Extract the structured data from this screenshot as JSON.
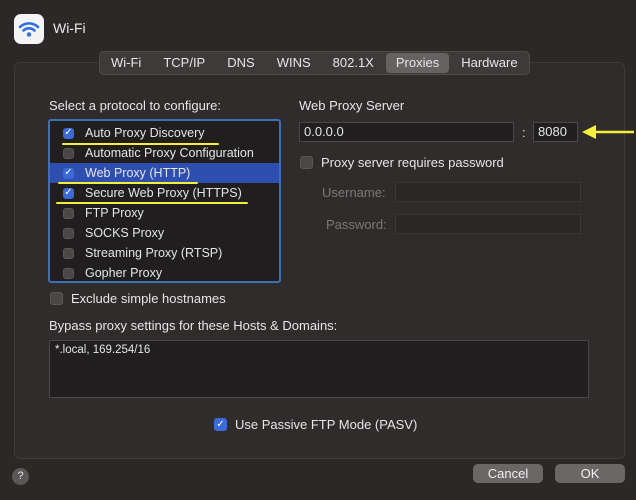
{
  "window": {
    "title": "Wi-Fi",
    "icon": "wifi-icon"
  },
  "tabs": [
    {
      "label": "Wi-Fi"
    },
    {
      "label": "TCP/IP"
    },
    {
      "label": "DNS"
    },
    {
      "label": "WINS"
    },
    {
      "label": "802.1X"
    },
    {
      "label": "Proxies",
      "active": true
    },
    {
      "label": "Hardware"
    }
  ],
  "protocols": {
    "heading": "Select a protocol to configure:",
    "items": [
      {
        "label": "Auto Proxy Discovery",
        "checked": true
      },
      {
        "label": "Automatic Proxy Configuration",
        "checked": false
      },
      {
        "label": "Web Proxy (HTTP)",
        "checked": true,
        "selected": true
      },
      {
        "label": "Secure Web Proxy (HTTPS)",
        "checked": true
      },
      {
        "label": "FTP Proxy",
        "checked": false
      },
      {
        "label": "SOCKS Proxy",
        "checked": false
      },
      {
        "label": "Streaming Proxy (RTSP)",
        "checked": false
      },
      {
        "label": "Gopher Proxy",
        "checked": false
      }
    ]
  },
  "exclude_simple": {
    "label": "Exclude simple hostnames",
    "checked": false
  },
  "server": {
    "heading": "Web Proxy Server",
    "address": "0.0.0.0",
    "separator": ":",
    "port": "8080",
    "requires_password_label": "Proxy server requires password",
    "username_label": "Username:",
    "password_label": "Password:"
  },
  "bypass": {
    "label": "Bypass proxy settings for these Hosts & Domains:",
    "value": "*.local, 169.254/16"
  },
  "passive_ftp": {
    "label": "Use Passive FTP Mode (PASV)",
    "checked": true
  },
  "buttons": {
    "help": "?",
    "cancel": "Cancel",
    "ok": "OK"
  },
  "colors": {
    "accent": "#3b6ad8",
    "selection": "#2f4fb0",
    "annotation": "#f3ef3a"
  }
}
